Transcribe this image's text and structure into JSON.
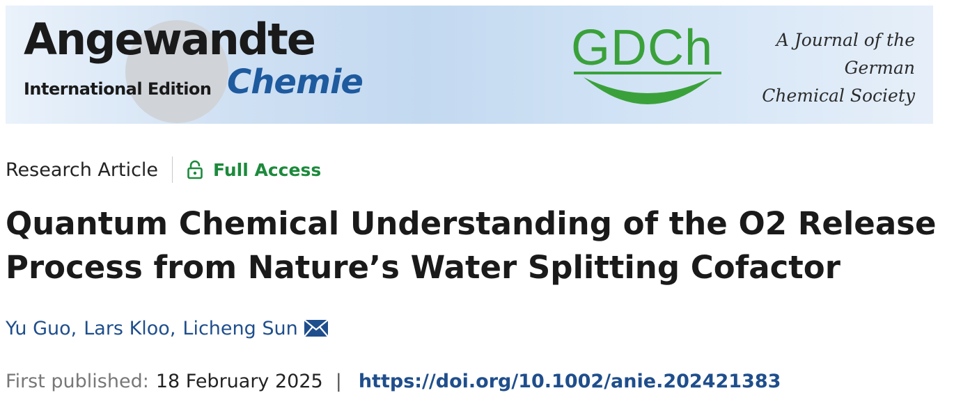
{
  "banner": {
    "brand_name": "Angewandte",
    "brand_edition": "International Edition",
    "brand_chemie": "Chemie",
    "society_logo_text": "GDCh",
    "society_lines": [
      "A Journal of the",
      "German",
      "Chemical Society"
    ],
    "colors": {
      "brand_blue": "#1e5a9e",
      "gdch_green": "#3aa13a"
    }
  },
  "article": {
    "type": "Research Article",
    "access_icon": "open-lock-icon",
    "access_label": "Full Access",
    "title_lines": [
      "Quantum Chemical Understanding of the O2 Release",
      "Process from Nature’s Water Splitting Cofactor"
    ],
    "authors": [
      "Yu Guo,",
      "Lars Kloo,",
      "Licheng Sun"
    ],
    "contact_icon": "envelope-icon",
    "first_published_label": "First published:",
    "first_published_date": "18 February 2025",
    "separator": "|",
    "doi": "https://doi.org/10.1002/anie.202421383",
    "colors": {
      "access_green": "#1c8a3c",
      "link_blue": "#1f4e8c"
    }
  }
}
